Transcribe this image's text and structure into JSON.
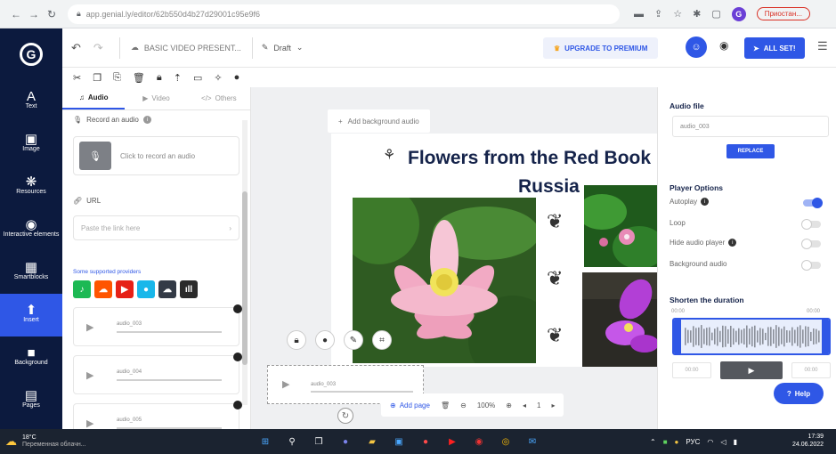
{
  "browser": {
    "url": "app.genial.ly/editor/62b550d4b27d29001c95e9f6",
    "pause_label": "Приостан..."
  },
  "rail": {
    "logo": "G",
    "items": [
      {
        "label": "Text",
        "icon": "A"
      },
      {
        "label": "Image",
        "icon": "▣"
      },
      {
        "label": "Resources",
        "icon": "❋"
      },
      {
        "label": "Interactive elements",
        "icon": "◉"
      },
      {
        "label": "Smartblocks",
        "icon": "▦"
      },
      {
        "label": "Insert",
        "icon": "⬆"
      },
      {
        "label": "Background",
        "icon": "■"
      },
      {
        "label": "Pages",
        "icon": "▤"
      }
    ]
  },
  "toolbar": {
    "project_title": "BASIC VIDEO PRESENT...",
    "status": "Draft",
    "upgrade_label": "UPGRADE TO PREMIUM",
    "allset_label": "ALL SET!"
  },
  "panel": {
    "tabs": [
      {
        "label": "Audio"
      },
      {
        "label": "Video"
      },
      {
        "label": "Others"
      }
    ],
    "record_heading": "Record an audio",
    "record_prompt": "Click to record an audio",
    "url_heading": "URL",
    "url_placeholder": "Paste the link here",
    "providers_heading": "Some supported providers",
    "providers": [
      {
        "name": "spotify",
        "color": "#1db954",
        "glyph": "♪"
      },
      {
        "name": "soundcloud",
        "color": "#ff5500",
        "glyph": "☁"
      },
      {
        "name": "youtube",
        "color": "#e62117",
        "glyph": "▶"
      },
      {
        "name": "vimeo",
        "color": "#19b7ea",
        "glyph": "●"
      },
      {
        "name": "audio-cloud",
        "color": "#333a46",
        "glyph": "☁"
      },
      {
        "name": "audio-wave",
        "color": "#2b2b2b",
        "glyph": "ıll"
      }
    ],
    "audio_items": [
      {
        "name": "audio_003"
      },
      {
        "name": "audio_004"
      },
      {
        "name": "audio_005"
      }
    ]
  },
  "canvas": {
    "bg_audio_label": "Add background audio",
    "title_line1": "Flowers from the Red Book",
    "title_line2": "Russia",
    "selected_audio": "audio_003",
    "add_page_label": "Add page",
    "zoom": "100%",
    "page_number": "1"
  },
  "props": {
    "audio_file_heading": "Audio file",
    "audio_file_value": "audio_003",
    "replace_label": "REPLACE",
    "player_options_heading": "Player Options",
    "options": [
      {
        "label": "Autoplay",
        "on": true,
        "info": true
      },
      {
        "label": "Loop",
        "on": false,
        "info": false
      },
      {
        "label": "Hide audio player",
        "on": false,
        "info": true
      },
      {
        "label": "Background audio",
        "on": false,
        "info": false
      }
    ],
    "shorten_heading": "Shorten the duration",
    "time_start": "00:00",
    "time_end": "00:00",
    "trim_start": "00:00",
    "trim_end": "00:00",
    "help_label": "Help"
  },
  "taskbar": {
    "temperature": "18°C",
    "weather_text": "Переменная облачн...",
    "language": "РУС",
    "time": "17:39",
    "date": "24.06.2022"
  }
}
